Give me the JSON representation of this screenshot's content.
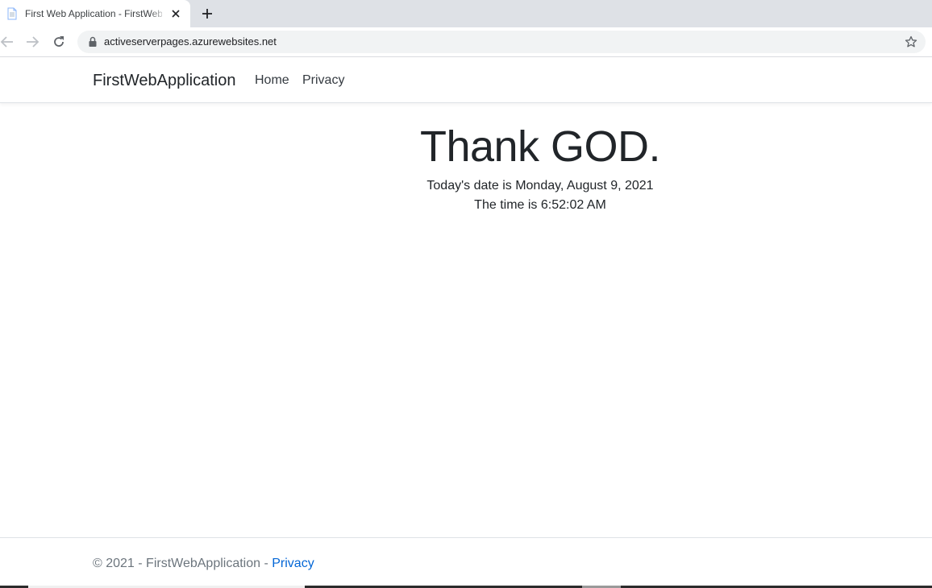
{
  "browser": {
    "tab": {
      "title": "First Web Application - FirstWebApplication",
      "favicon": "page-icon",
      "close_icon": "close-icon"
    },
    "new_tab_icon": "plus-icon",
    "toolbar": {
      "back_icon": "arrow-left-icon",
      "forward_icon": "arrow-right-icon",
      "reload_icon": "reload-icon",
      "lock_icon": "lock-icon",
      "url": "activeserverpages.azurewebsites.net",
      "bookmark_icon": "star-icon"
    }
  },
  "site": {
    "brand": "FirstWebApplication",
    "nav": [
      {
        "label": "Home"
      },
      {
        "label": "Privacy"
      }
    ]
  },
  "main": {
    "heading": "Thank GOD.",
    "date_line": "Today's date is Monday, August 9, 2021",
    "time_line": "The time is 6:52:02 AM"
  },
  "footer": {
    "text": "© 2021 - FirstWebApplication - ",
    "link": "Privacy"
  },
  "colors": {
    "tabstrip_bg": "#dee1e6",
    "omnibox_bg": "#f1f3f4",
    "link": "#0366d6",
    "muted": "#6c757d",
    "text": "#212529"
  }
}
